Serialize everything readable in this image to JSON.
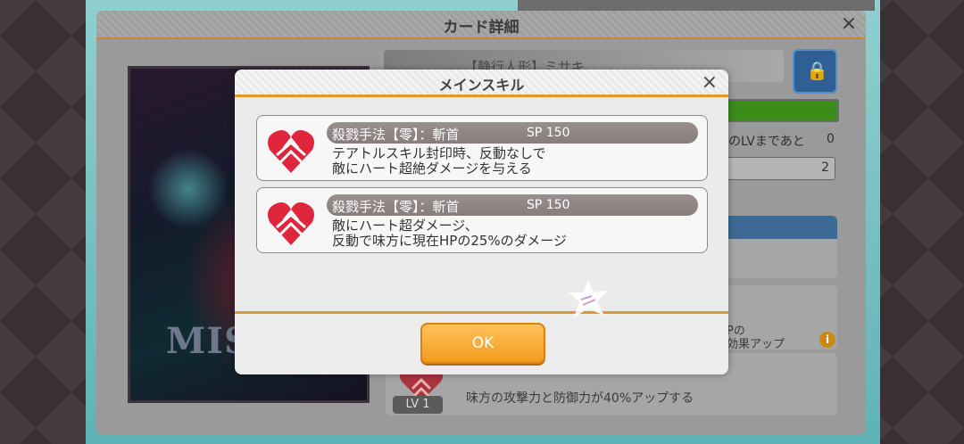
{
  "background_detail": {
    "title": "カード詳細",
    "close_icon": "×",
    "card_name": "【静行人形】ミサキ",
    "card_art_text": "MIS",
    "exp_text": "のLVまであと",
    "exp_value": "0",
    "level_value": "2",
    "panel2_line1": "Pの",
    "panel2_line2": "効果アップ",
    "info_icon": "i",
    "bottom_lv_badge": "LV 1",
    "bottom_description": "味方の攻撃力と防御力が40%アップする"
  },
  "modal": {
    "title": "メインスキル",
    "close_icon": "×",
    "skills": [
      {
        "name": "殺戮手法【零】：斬首",
        "sp": "SP  150",
        "desc_line1": "テアトルスキル封印時、反動なしで",
        "desc_line2": "敵にハート超絶ダメージを与える"
      },
      {
        "name": "殺戮手法【零】：斬首",
        "sp": "SP  150",
        "desc_line1": "敵にハート超ダメージ、",
        "desc_line2": "反動で味方に現在HPの25%のダメージ"
      }
    ],
    "ok_label": "OK"
  },
  "colors": {
    "accent_orange": "#e4952c",
    "ok_button": "#f49b1e",
    "skill_icon_red": "#e0263c"
  },
  "icons": {
    "skill_icon": "red-heart-slash-icon",
    "lock_icon": "lock-icon"
  }
}
